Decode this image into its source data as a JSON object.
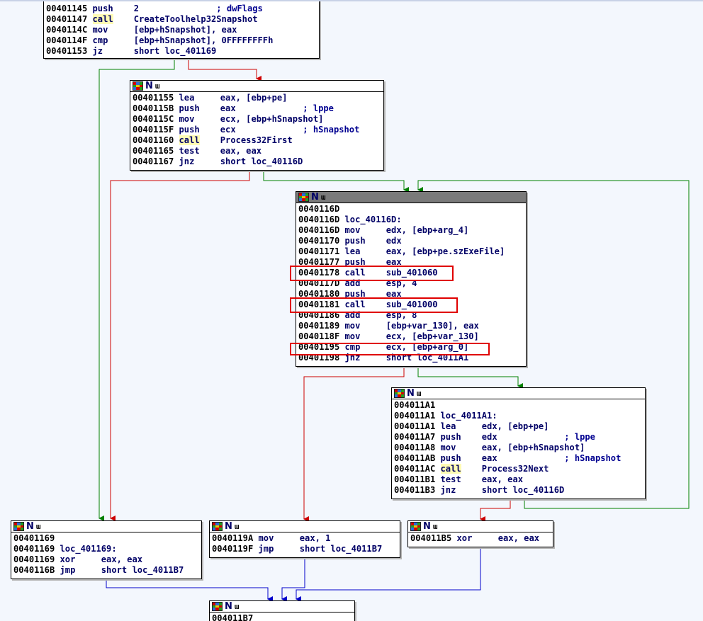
{
  "colors": {
    "edge_true": "#008000",
    "edge_false": "#cc0000",
    "edge_uncond": "#0000cc",
    "highlight_box": "#e00000",
    "call_highlight": "#fffbb4"
  },
  "icons": [
    "block-color-grid-icon",
    "n-mark-icon",
    "graph-overview-icon"
  ],
  "header_labels": {
    "n": "N",
    "graph": "ɯ"
  },
  "blocks": {
    "block1": {
      "lines": [
        {
          "addr": "00401145",
          "mn": "push",
          "op": "2",
          "cmt": "; dwFlags"
        },
        {
          "addr": "00401147",
          "mn": "call",
          "op": "CreateToolhelp32Snapshot"
        },
        {
          "addr": "0040114C",
          "mn": "mov",
          "op": "[ebp+hSnapshot], eax"
        },
        {
          "addr": "0040114F",
          "mn": "cmp",
          "op": "[ebp+hSnapshot], 0FFFFFFFFh"
        },
        {
          "addr": "00401153",
          "mn": "jz",
          "op": "short loc_401169"
        }
      ]
    },
    "block2": {
      "lines": [
        {
          "addr": "00401155",
          "mn": "lea",
          "op": "eax, [ebp+pe]"
        },
        {
          "addr": "0040115B",
          "mn": "push",
          "op": "eax",
          "cmt": "; lppe"
        },
        {
          "addr": "0040115C",
          "mn": "mov",
          "op": "ecx, [ebp+hSnapshot]"
        },
        {
          "addr": "0040115F",
          "mn": "push",
          "op": "ecx",
          "cmt": "; hSnapshot"
        },
        {
          "addr": "00401160",
          "mn": "call",
          "op": "Process32First"
        },
        {
          "addr": "00401165",
          "mn": "test",
          "op": "eax, eax"
        },
        {
          "addr": "00401167",
          "mn": "jnz",
          "op": "short loc_40116D"
        }
      ]
    },
    "block3": {
      "lines": [
        {
          "addr": "0040116D",
          "mn": "",
          "op": ""
        },
        {
          "addr": "0040116D",
          "mn": "loc_40116D:",
          "op": ""
        },
        {
          "addr": "0040116D",
          "mn": "mov",
          "op": "edx, [ebp+arg_4]"
        },
        {
          "addr": "00401170",
          "mn": "push",
          "op": "edx"
        },
        {
          "addr": "00401171",
          "mn": "lea",
          "op": "eax, [ebp+pe.szExeFile]"
        },
        {
          "addr": "00401177",
          "mn": "push",
          "op": "eax"
        },
        {
          "addr": "00401178",
          "mn": "call",
          "op": "sub_401060"
        },
        {
          "addr": "0040117D",
          "mn": "add",
          "op": "esp, 4"
        },
        {
          "addr": "00401180",
          "mn": "push",
          "op": "eax"
        },
        {
          "addr": "00401181",
          "mn": "call",
          "op": "sub_401000"
        },
        {
          "addr": "00401186",
          "mn": "add",
          "op": "esp, 8"
        },
        {
          "addr": "00401189",
          "mn": "mov",
          "op": "[ebp+var_130], eax"
        },
        {
          "addr": "0040118F",
          "mn": "mov",
          "op": "ecx, [ebp+var_130]"
        },
        {
          "addr": "00401195",
          "mn": "cmp",
          "op": "ecx, [ebp+arg_0]"
        },
        {
          "addr": "00401198",
          "mn": "jnz",
          "op": "short loc_4011A1"
        }
      ]
    },
    "block4": {
      "lines": [
        {
          "addr": "004011A1",
          "mn": "",
          "op": ""
        },
        {
          "addr": "004011A1",
          "mn": "loc_4011A1:",
          "op": ""
        },
        {
          "addr": "004011A1",
          "mn": "lea",
          "op": "edx, [ebp+pe]"
        },
        {
          "addr": "004011A7",
          "mn": "push",
          "op": "edx",
          "cmt": "; lppe"
        },
        {
          "addr": "004011A8",
          "mn": "mov",
          "op": "eax, [ebp+hSnapshot]"
        },
        {
          "addr": "004011AB",
          "mn": "push",
          "op": "eax",
          "cmt": "; hSnapshot"
        },
        {
          "addr": "004011AC",
          "mn": "call",
          "op": "Process32Next"
        },
        {
          "addr": "004011B1",
          "mn": "test",
          "op": "eax, eax"
        },
        {
          "addr": "004011B3",
          "mn": "jnz",
          "op": "short loc_40116D"
        }
      ]
    },
    "block5": {
      "lines": [
        {
          "addr": "00401169",
          "mn": "",
          "op": ""
        },
        {
          "addr": "00401169",
          "mn": "loc_401169:",
          "op": ""
        },
        {
          "addr": "00401169",
          "mn": "xor",
          "op": "eax, eax"
        },
        {
          "addr": "0040116B",
          "mn": "jmp",
          "op": "short loc_4011B7"
        }
      ]
    },
    "block6": {
      "lines": [
        {
          "addr": "0040119A",
          "mn": "mov",
          "op": "eax, 1"
        },
        {
          "addr": "0040119F",
          "mn": "jmp",
          "op": "short loc_4011B7"
        }
      ]
    },
    "block7": {
      "lines": [
        {
          "addr": "004011B5",
          "mn": "xor",
          "op": "eax, eax"
        }
      ]
    },
    "block8": {
      "lines": [
        {
          "addr": "004011B7",
          "mn": "",
          "op": ""
        }
      ]
    }
  }
}
